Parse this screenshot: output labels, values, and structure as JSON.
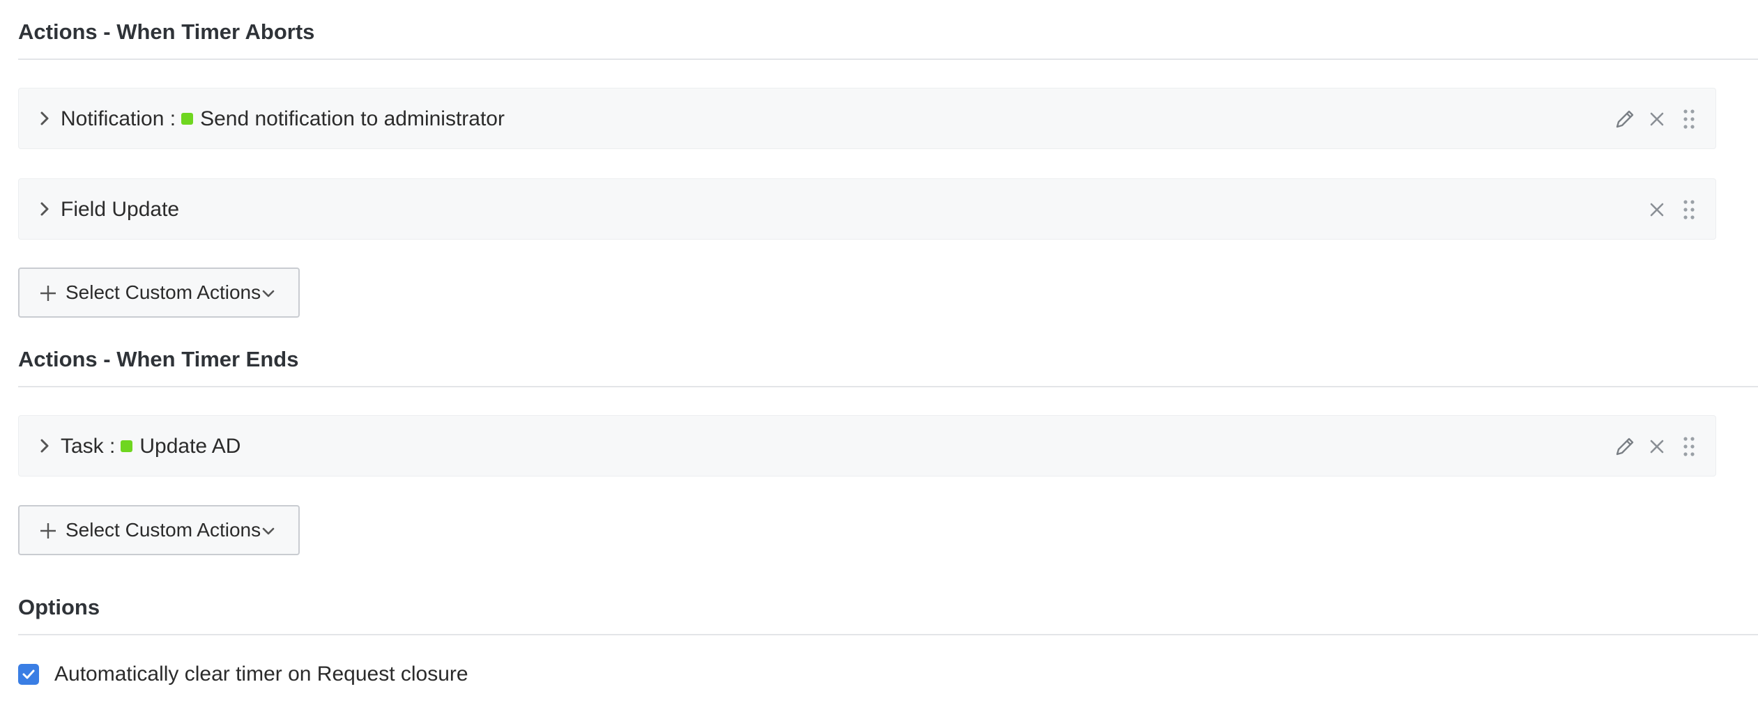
{
  "sections": {
    "aborts": {
      "title": "Actions - When Timer Aborts",
      "actions": [
        {
          "type_label": "Notification :",
          "value": "Send notification to administrator",
          "status_color": "#6fd620"
        },
        {
          "type_label": "Field Update"
        }
      ],
      "add_button_label": "Select Custom Actions"
    },
    "ends": {
      "title": "Actions - When Timer Ends",
      "actions": [
        {
          "type_label": "Task :",
          "value": "Update AD",
          "status_color": "#6fd620"
        }
      ],
      "add_button_label": "Select Custom Actions"
    },
    "options": {
      "title": "Options",
      "auto_clear": {
        "label": "Automatically clear timer on Request closure",
        "checked": true
      }
    }
  },
  "colors": {
    "accent": "#3a7ee4",
    "status_green": "#6fd620"
  },
  "icons": [
    "chevron-right-icon",
    "pencil-icon",
    "close-icon",
    "drag-handle-icon",
    "plus-icon",
    "chevron-down-icon",
    "checkmark-icon"
  ]
}
